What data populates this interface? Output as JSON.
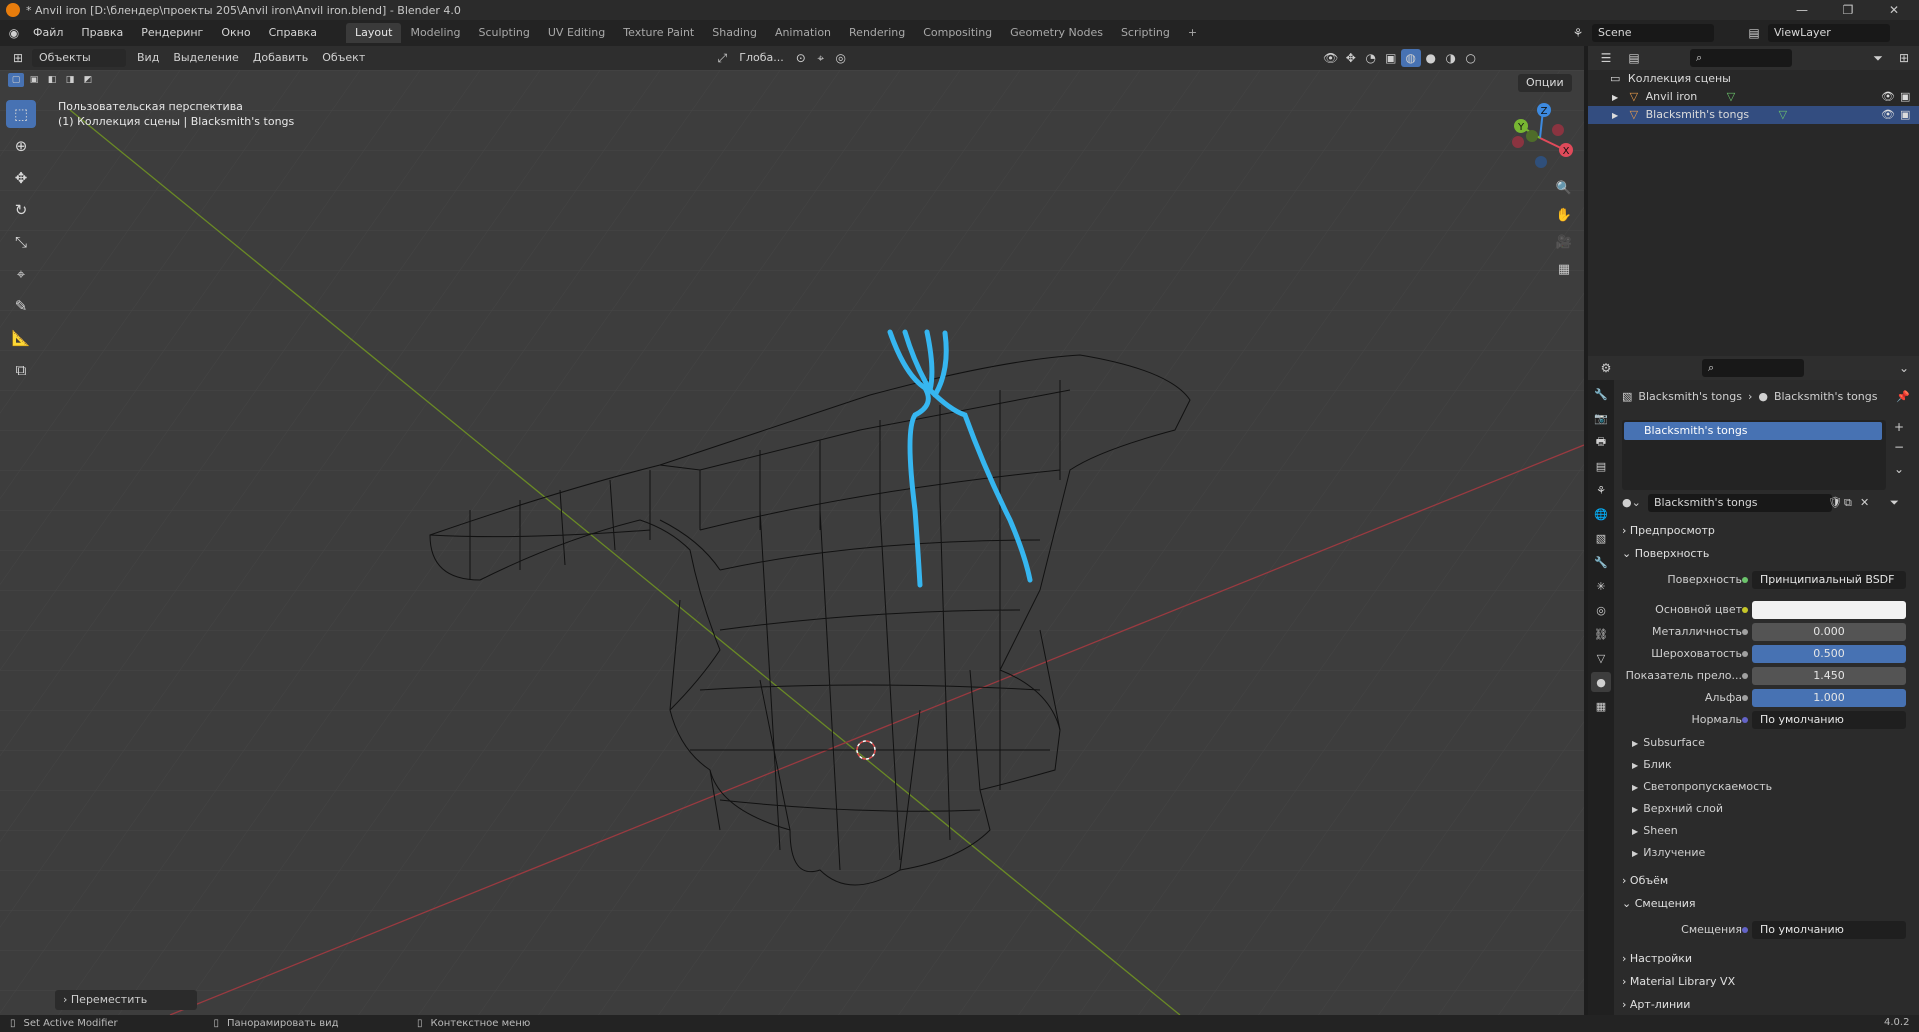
{
  "window": {
    "title": "* Anvil iron [D:\\блендер\\проекты 205\\Anvil iron\\Anvil iron.blend] - Blender 4.0",
    "min": "—",
    "max": "❐",
    "close": "✕"
  },
  "menubar": {
    "items": [
      "Файл",
      "Правка",
      "Рендеринг",
      "Окно",
      "Справка"
    ],
    "workspaces": [
      "Layout",
      "Modeling",
      "Sculpting",
      "UV Editing",
      "Texture Paint",
      "Shading",
      "Animation",
      "Rendering",
      "Compositing",
      "Geometry Nodes",
      "Scripting"
    ],
    "add_tab": "+",
    "scene": "Scene",
    "view_layer": "ViewLayer"
  },
  "viewport_header": {
    "mode": "Объекты",
    "menus": [
      "Вид",
      "Выделение",
      "Добавить",
      "Объект"
    ],
    "transform": "Глоба...",
    "options": "Опции"
  },
  "viewport": {
    "view_name": "Пользовательская перспектива",
    "collection_info": "(1) Коллекция сцены | Blacksmith's tongs",
    "last_operator": "Переместить",
    "gizmo": {
      "x": "X",
      "y": "Y",
      "z": "Z"
    }
  },
  "outliner": {
    "root": "Коллекция сцены",
    "items": [
      {
        "name": "Anvil iron",
        "selected": false
      },
      {
        "name": "Blacksmith's tongs",
        "selected": true
      }
    ]
  },
  "properties": {
    "breadcrumb_object": "Blacksmith's tongs",
    "breadcrumb_material": "Blacksmith's tongs",
    "slot": "Blacksmith's tongs",
    "material_name": "Blacksmith's tongs",
    "panels": {
      "preview": "Предпросмотр",
      "surface": "Поверхность",
      "volume": "Объём",
      "displacement": "Смещения",
      "settings": "Настройки",
      "material_library": "Material Library VX",
      "lineart": "Арт-линии"
    },
    "surface_fields": [
      {
        "label": "Поверхность",
        "value": "Принципиальный BSDF",
        "type": "dark"
      },
      {
        "label": "Основной цвет",
        "value": "",
        "type": "color"
      },
      {
        "label": "Металличность",
        "value": "0.000",
        "type": "num"
      },
      {
        "label": "Шероховатость",
        "value": "0.500",
        "type": "blue"
      },
      {
        "label": "Показатель прело...",
        "value": "1.450",
        "type": "num"
      },
      {
        "label": "Альфа",
        "value": "1.000",
        "type": "blue"
      },
      {
        "label": "Нормаль",
        "value": "По умолчанию",
        "type": "dark"
      }
    ],
    "subpanels": [
      "Subsurface",
      "Блик",
      "Светопропускаемость",
      "Верхний слой",
      "Sheen",
      "Излучение"
    ],
    "displacement_label": "Смещения",
    "displacement_value": "По умолчанию"
  },
  "statusbar": {
    "hint1": "Set Active Modifier",
    "hint2": "Панорамировать вид",
    "hint3": "Контекстное меню",
    "version": "4.0.2"
  },
  "colors": {
    "accent": "#4772b3",
    "selection": "#334d80",
    "tongs": "#36b6f0"
  }
}
